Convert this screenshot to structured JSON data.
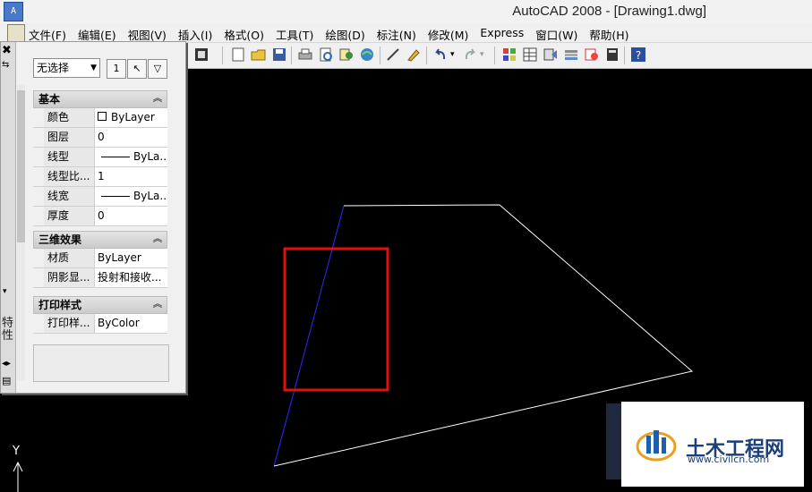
{
  "window": {
    "title": "AutoCAD 2008 - [Drawing1.dwg]",
    "app_icon_text": "A"
  },
  "menu": {
    "items": [
      "文件(F)",
      "编辑(E)",
      "视图(V)",
      "插入(I)",
      "格式(O)",
      "工具(T)",
      "绘图(D)",
      "标注(N)",
      "修改(M)",
      "Express",
      "窗口(W)",
      "帮助(H)"
    ]
  },
  "toolbar": {
    "icons": [
      "new-icon",
      "open-icon",
      "save-icon",
      "print-icon",
      "plot-preview-icon",
      "publish-icon",
      "3d-dwf-icon",
      "cut-icon",
      "match-properties-icon",
      "undo-icon",
      "redo-icon",
      "design-center-icon",
      "properties-icon",
      "tool-palettes-icon",
      "sheet-set-icon",
      "markup-icon",
      "calculator-icon",
      "help-icon"
    ]
  },
  "palette": {
    "selection": "无选择",
    "sections": [
      {
        "title": "基本",
        "rows": [
          {
            "name": "颜色",
            "value": "ByLayer",
            "swatch": true
          },
          {
            "name": "图层",
            "value": "0"
          },
          {
            "name": "线型",
            "value": "ByLa...",
            "line": true
          },
          {
            "name": "线型比...",
            "value": "1"
          },
          {
            "name": "线宽",
            "value": "ByLa...",
            "line": true
          },
          {
            "name": "厚度",
            "value": "0"
          }
        ]
      },
      {
        "title": "三维效果",
        "rows": [
          {
            "name": "材质",
            "value": "ByLayer"
          },
          {
            "name": "阴影显...",
            "value": "投射和接收..."
          }
        ]
      },
      {
        "title": "打印样式",
        "rows": [
          {
            "name": "打印样...",
            "value": "ByColor"
          }
        ]
      }
    ],
    "vertical_label": "特性"
  },
  "ucs": {
    "y_label": "Y"
  },
  "watermark": {
    "brand": "土木工程网",
    "url": "www.civilcn.com"
  },
  "colors": {
    "canvas": "#000000",
    "line_white": "#ffffff",
    "line_blue": "#2a2aff",
    "highlight_red": "#e01010"
  }
}
